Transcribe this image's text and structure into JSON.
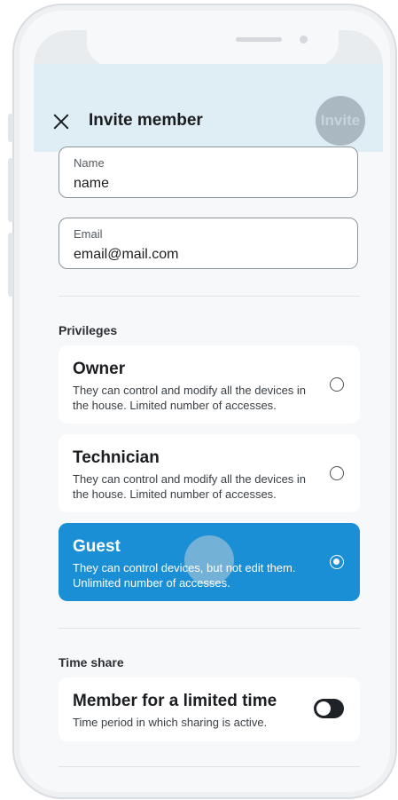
{
  "header": {
    "title": "Invite member",
    "invite_label": "Invite"
  },
  "form": {
    "name": {
      "label": "Name",
      "value": "name"
    },
    "email": {
      "label": "Email",
      "value": "email@mail.com"
    }
  },
  "privileges": {
    "section_label": "Privileges",
    "options": [
      {
        "title": "Owner",
        "description": "They can control and modify all the devices in the house. Limited number of accesses.",
        "selected": false
      },
      {
        "title": "Technician",
        "description": "They can control and modify all the devices in the house. Limited number of accesses.",
        "selected": false
      },
      {
        "title": "Guest",
        "description": "They can control devices, but not edit them. Unlimited number of accesses.",
        "selected": true
      }
    ]
  },
  "time_share": {
    "section_label": "Time share",
    "title": "Member for a limited time",
    "description": "Time period in which sharing is active.",
    "enabled": false
  },
  "colors": {
    "accent": "#1a8fd6",
    "header_bg": "#dfeef5"
  }
}
